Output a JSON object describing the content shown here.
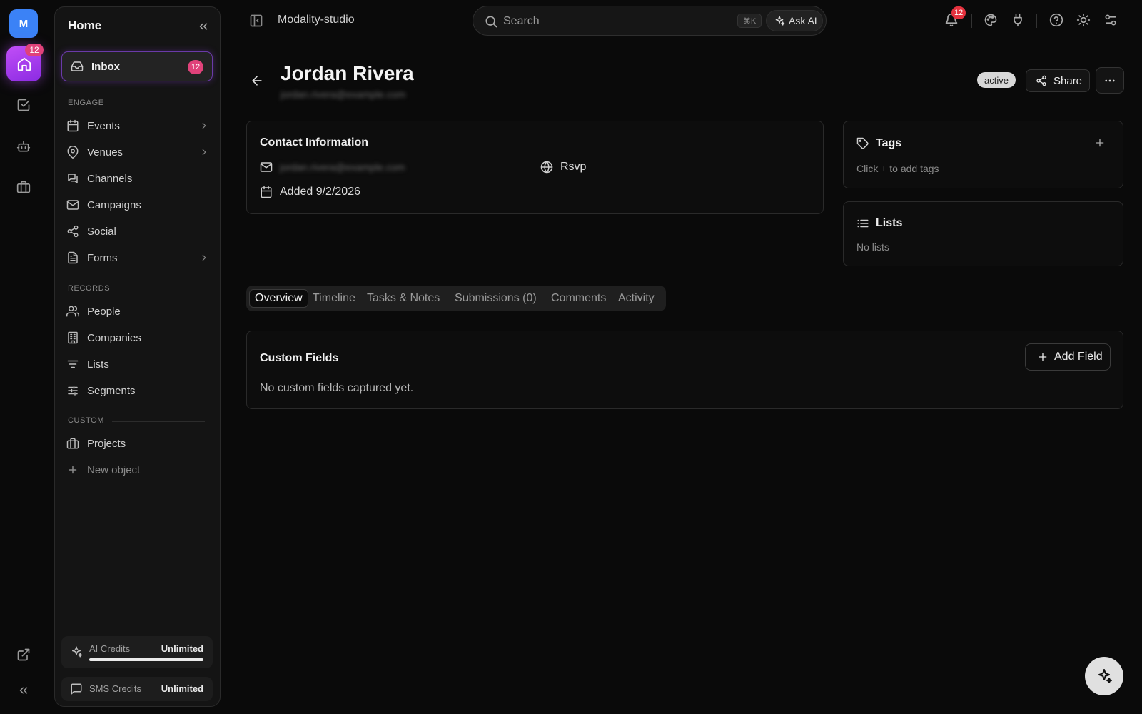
{
  "workspace": {
    "initial": "M",
    "home_badge": "12"
  },
  "sidebar": {
    "title": "Home",
    "inbox": {
      "label": "Inbox",
      "badge": "12"
    },
    "sections": {
      "engage": "ENGAGE",
      "records": "RECORDS",
      "custom": "CUSTOM"
    },
    "engage_items": [
      {
        "label": "Events",
        "icon": "calendar-icon",
        "has_submenu": true
      },
      {
        "label": "Venues",
        "icon": "map-pin-icon",
        "has_submenu": true
      },
      {
        "label": "Channels",
        "icon": "channels-icon",
        "has_submenu": false
      },
      {
        "label": "Campaigns",
        "icon": "mail-icon",
        "has_submenu": false
      },
      {
        "label": "Social",
        "icon": "share-icon",
        "has_submenu": false
      },
      {
        "label": "Forms",
        "icon": "file-text-icon",
        "has_submenu": true
      }
    ],
    "records_items": [
      {
        "label": "People",
        "icon": "users-icon"
      },
      {
        "label": "Companies",
        "icon": "building-icon"
      },
      {
        "label": "Lists",
        "icon": "list-filter-icon"
      },
      {
        "label": "Segments",
        "icon": "sliders-icon"
      }
    ],
    "custom_items": [
      {
        "label": "Projects",
        "icon": "briefcase-icon"
      }
    ],
    "new_object": "New object",
    "credits": [
      {
        "label": "AI Credits",
        "value": "Unlimited",
        "fill": 1.0
      },
      {
        "label": "SMS Credits",
        "value": "Unlimited"
      }
    ]
  },
  "topbar": {
    "title": "Modality-studio",
    "search_placeholder": "Search",
    "shortcut": "⌘K",
    "ask_ai": "Ask AI",
    "notification_badge": "12"
  },
  "contact": {
    "name": "Jordan Rivera",
    "email": "jordan.rivera@example.com",
    "status": "active",
    "share_label": "Share"
  },
  "contact_info": {
    "title": "Contact Information",
    "email": "jordan.rivera@example.com",
    "source": "Rsvp",
    "added": "Added 9/2/2026"
  },
  "tags": {
    "title": "Tags",
    "empty": "Click + to add tags"
  },
  "lists": {
    "title": "Lists",
    "empty": "No lists"
  },
  "tabs": [
    "Overview",
    "Timeline",
    "Tasks & Notes",
    "Submissions (0)",
    "Comments",
    "Activity"
  ],
  "custom_fields": {
    "title": "Custom Fields",
    "add_label": "Add Field",
    "empty": "No custom fields captured yet."
  },
  "colors": {
    "accent": "#a544ee",
    "badge": "#e0427a",
    "notif_badge": "#e5323e",
    "avatar": "#3b82f6"
  }
}
